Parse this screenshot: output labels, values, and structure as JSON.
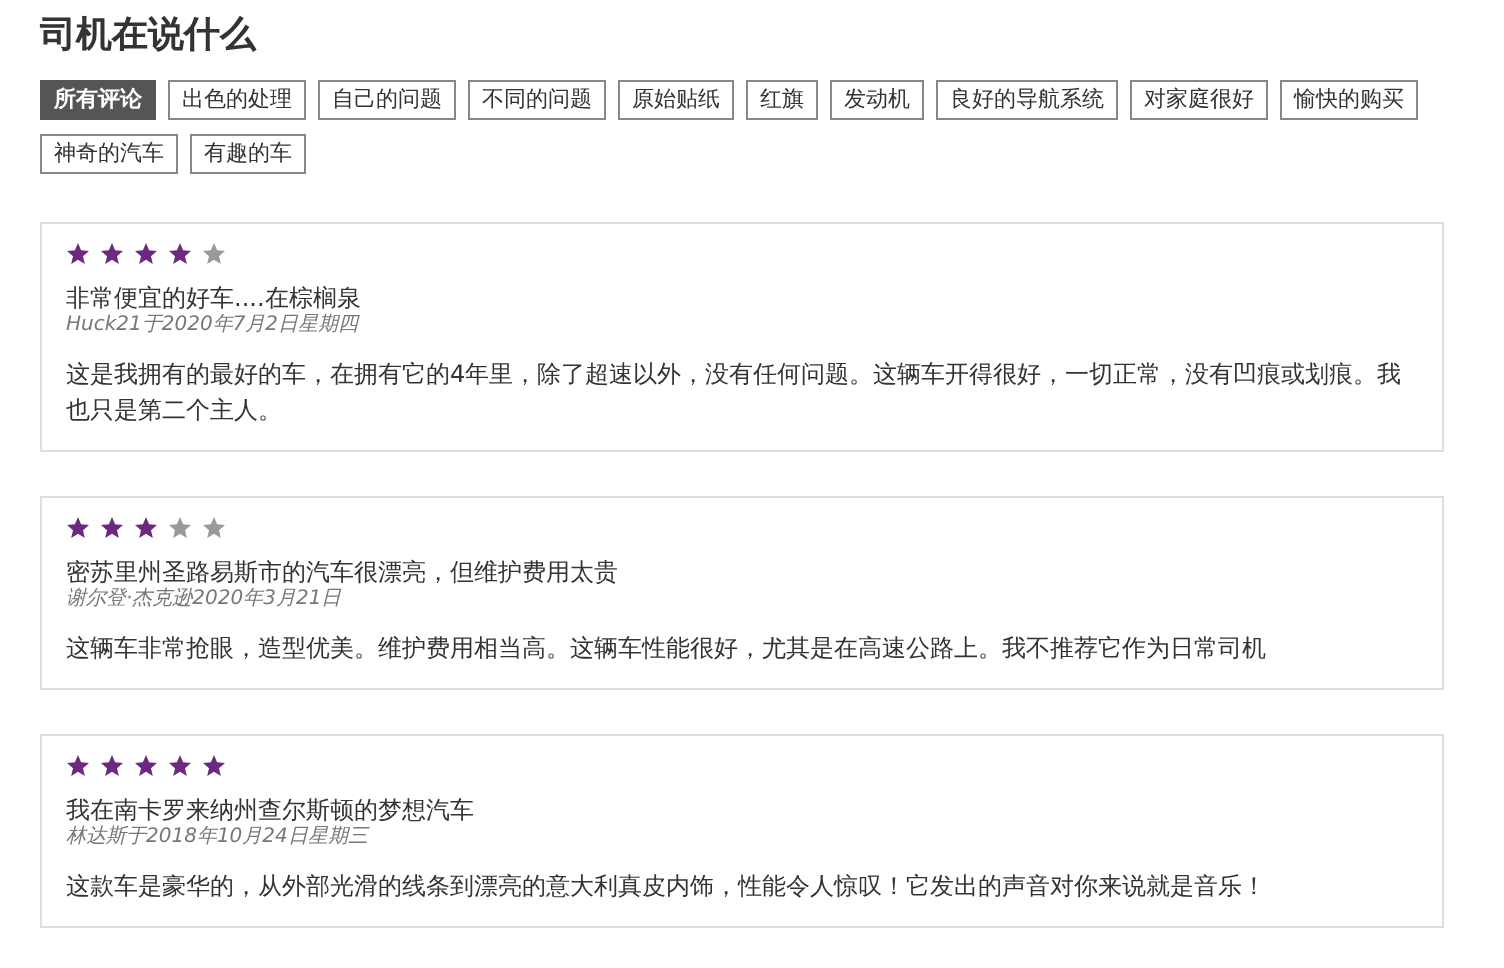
{
  "title": "司机在说什么",
  "tags": [
    {
      "label": "所有评论",
      "selected": true
    },
    {
      "label": "出色的处理",
      "selected": false
    },
    {
      "label": "自己的问题",
      "selected": false
    },
    {
      "label": "不同的问题",
      "selected": false
    },
    {
      "label": "原始贴纸",
      "selected": false
    },
    {
      "label": "红旗",
      "selected": false
    },
    {
      "label": "发动机",
      "selected": false
    },
    {
      "label": "良好的导航系统",
      "selected": false
    },
    {
      "label": "对家庭很好",
      "selected": false
    },
    {
      "label": "愉快的购买",
      "selected": false
    },
    {
      "label": "神奇的汽车",
      "selected": false
    },
    {
      "label": "有趣的车",
      "selected": false
    }
  ],
  "reviews": [
    {
      "stars": 4,
      "headline": "非常便宜的好车....在棕榈泉",
      "meta": "Huck21于2020年7月2日星期四",
      "body": "这是我拥有的最好的车，在拥有它的4年里，除了超速以外，没有任何问题。这辆车开得很好，一切正常，没有凹痕或划痕。我也只是第二个主人。"
    },
    {
      "stars": 3,
      "headline": "密苏里州圣路易斯市的汽车很漂亮，但维护费用太贵",
      "meta": "谢尔登·杰克逊2020年3月21日",
      "body": "这辆车非常抢眼，造型优美。维护费用相当高。这辆车性能很好，尤其是在高速公路上。我不推荐它作为日常司机"
    },
    {
      "stars": 5,
      "headline": "我在南卡罗来纳州查尔斯顿的梦想汽车",
      "meta": "林达斯于2018年10月24日星期三",
      "body": "这款车是豪华的，从外部光滑的线条到漂亮的意大利真皮内饰，性能令人惊叹！它发出的声音对你来说就是音乐！"
    }
  ]
}
